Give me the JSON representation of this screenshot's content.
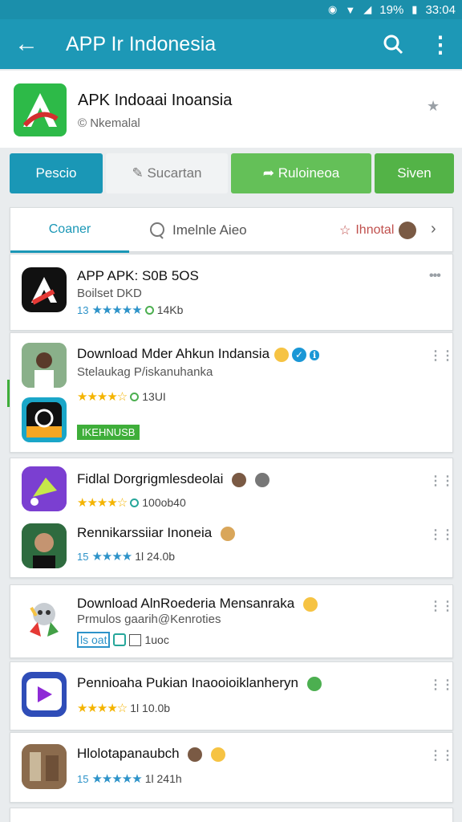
{
  "status": {
    "battery": "19%",
    "time": "33:04"
  },
  "appbar": {
    "title": "APP Ir Indonesia"
  },
  "header": {
    "name": "APK Indoaai Inoansia",
    "subtitle": "© Nkemalal"
  },
  "actions": {
    "a": "Pescio",
    "b": "Sucartan",
    "c": "Ruloineoa",
    "d": "Siven"
  },
  "subtabs": {
    "first": "Coaner",
    "second": "Imelnle Aieo",
    "third": "Ihnotal"
  },
  "rows": [
    {
      "title": "APP APK: S0B 5OS",
      "sub": "Boilset DKD",
      "rating_num": "13",
      "size": "14Kb"
    },
    {
      "title": "Download Mder Ahkun Indansia",
      "sub": "Stelaukag P/iskanuhanka",
      "size": "13UI",
      "tag": "IKEHNUSB"
    },
    {
      "title": "Fidlal Dorgrigmlesdeolai",
      "size": "100ob40"
    },
    {
      "title": "Rennikarssiiar Inoneia",
      "rating_num": "15",
      "size": "1l 24.0b"
    },
    {
      "title": "Download AlnRoederia Mensanraka",
      "sub": "Prmulos gaarih@Kenroties",
      "extra": "ls oat",
      "size": "1uoc"
    },
    {
      "title": "Pennioaha Pukian Inaooioiklanheryn",
      "size": "1l 10.0b"
    },
    {
      "title": "Hlolotapanaubch",
      "rating_num": "15",
      "size": "1l 241h"
    }
  ]
}
